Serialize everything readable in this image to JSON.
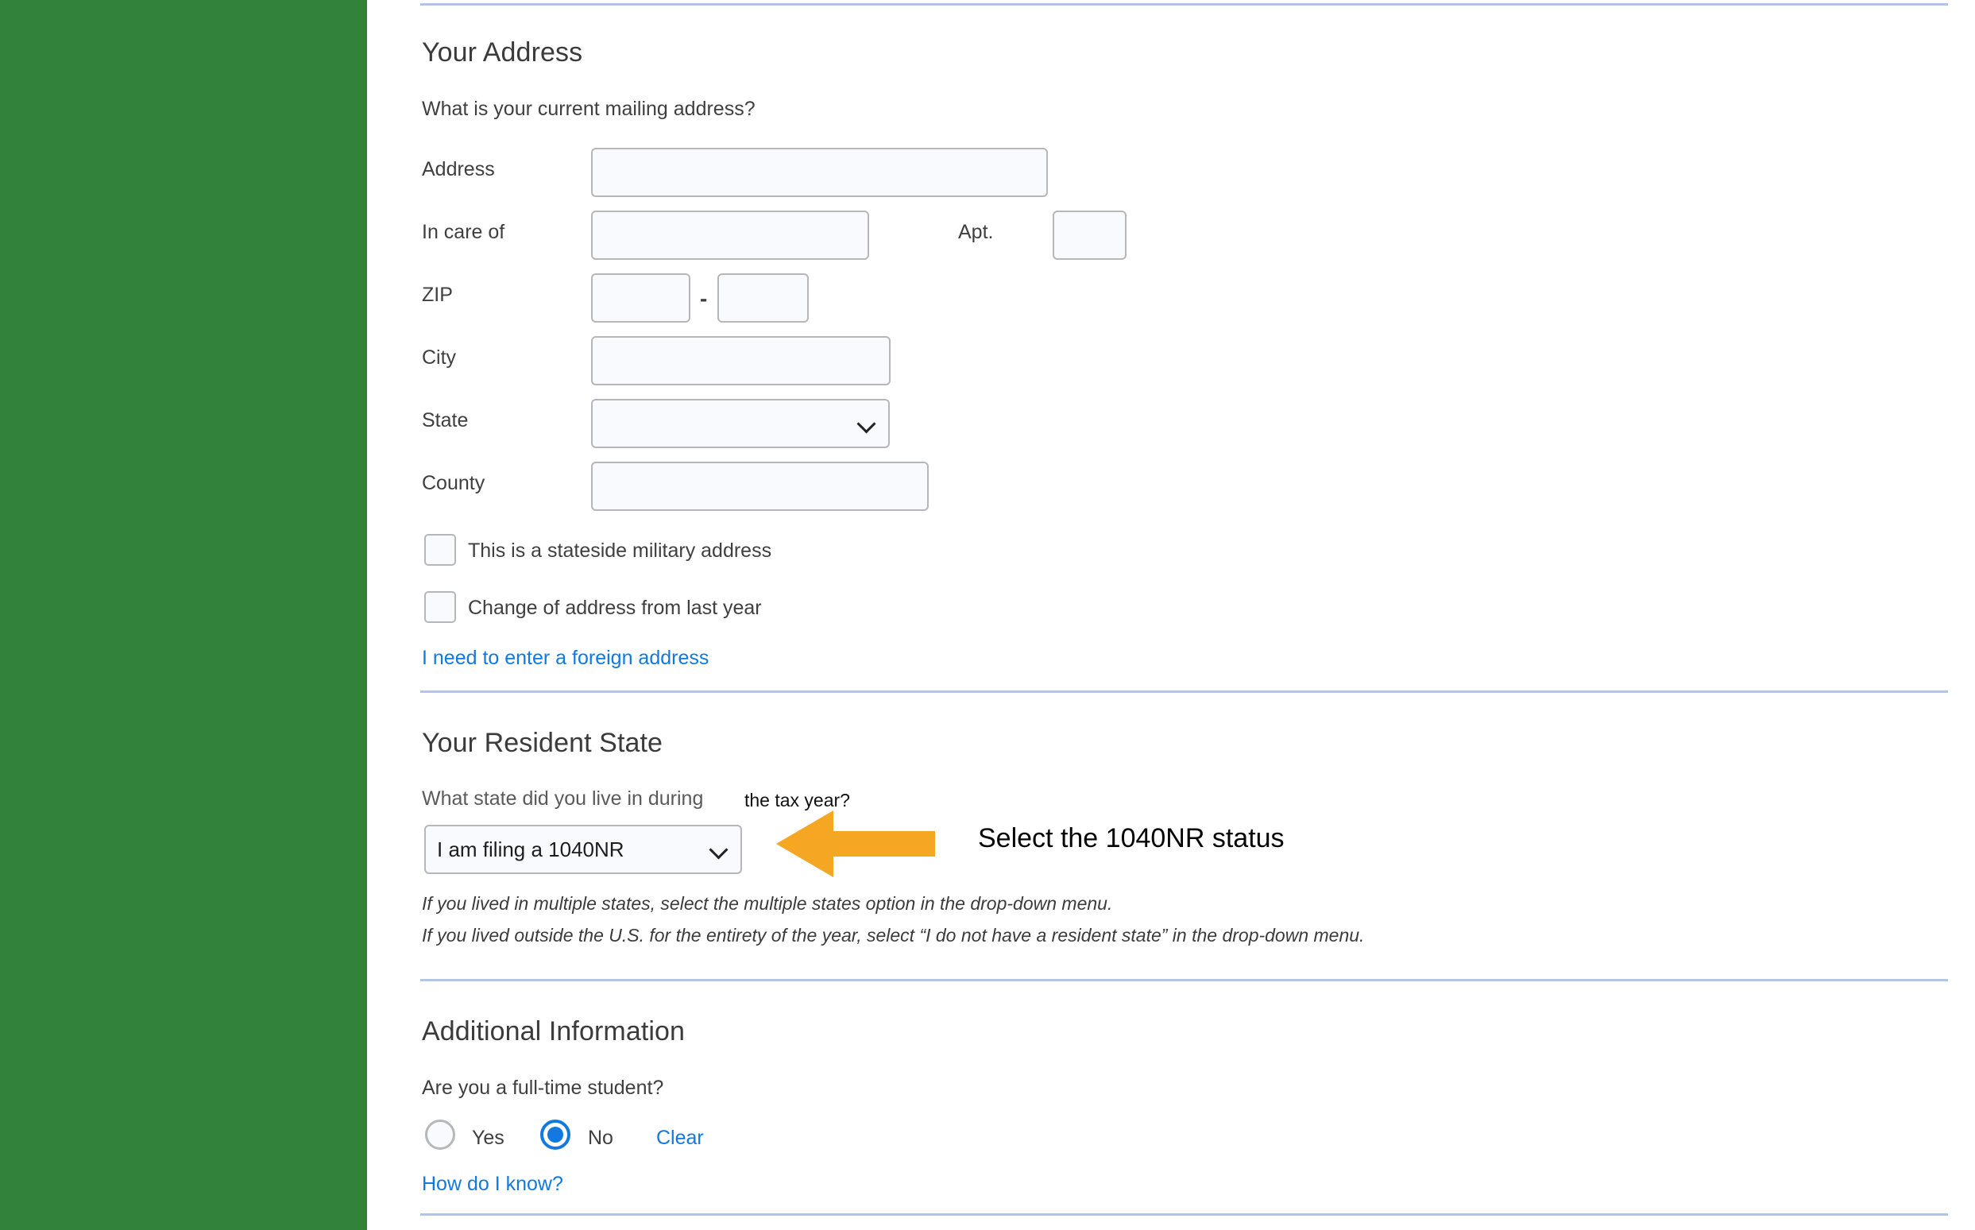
{
  "theme": {
    "sidebar_color": "#32823A",
    "divider_color": "#AFC6E9",
    "link_color": "#1279E0",
    "accent_arrow_color": "#F5A623",
    "input_bg": "#F9FAFD",
    "input_border": "#B5B7B9"
  },
  "address_section": {
    "title": "Your Address",
    "question": "What is your current mailing address?",
    "fields": {
      "address_label": "Address",
      "address_value": "",
      "in_care_of_label": "In care of",
      "in_care_of_value": "",
      "apt_label": "Apt.",
      "apt_value": "",
      "zip_label": "ZIP",
      "zip_value": "",
      "zip_ext_value": "",
      "zip_separator": "-",
      "city_label": "City",
      "city_value": "",
      "state_label": "State",
      "state_value": "",
      "county_label": "County",
      "county_value": ""
    },
    "checkboxes": [
      {
        "label": "This is a stateside military address",
        "checked": false
      },
      {
        "label": "Change of address from last year",
        "checked": false
      }
    ],
    "foreign_address_link": "I need to enter a foreign address"
  },
  "resident_state_section": {
    "title": "Your Resident State",
    "question": "What state did you live in during",
    "dropdown_value": "I am filing a 1040NR",
    "helper_lines": [
      "If you lived in multiple states, select the multiple states option in the drop-down menu.",
      "If you lived outside the U.S. for the entirety of the year, select “I do not have a resident state” in the drop-down menu."
    ]
  },
  "additional_information_section": {
    "title": "Additional Information",
    "question": "Are you a full-time student?",
    "radios": [
      {
        "label": "Yes",
        "selected": false
      },
      {
        "label": "No",
        "selected": true
      }
    ],
    "clear_label": "Clear",
    "how_do_i_know_link": "How do I know?"
  },
  "annotations": {
    "question_suffix": "the tax year?",
    "callout": "Select the 1040NR status",
    "arrow": "left-arrow-annotation"
  }
}
